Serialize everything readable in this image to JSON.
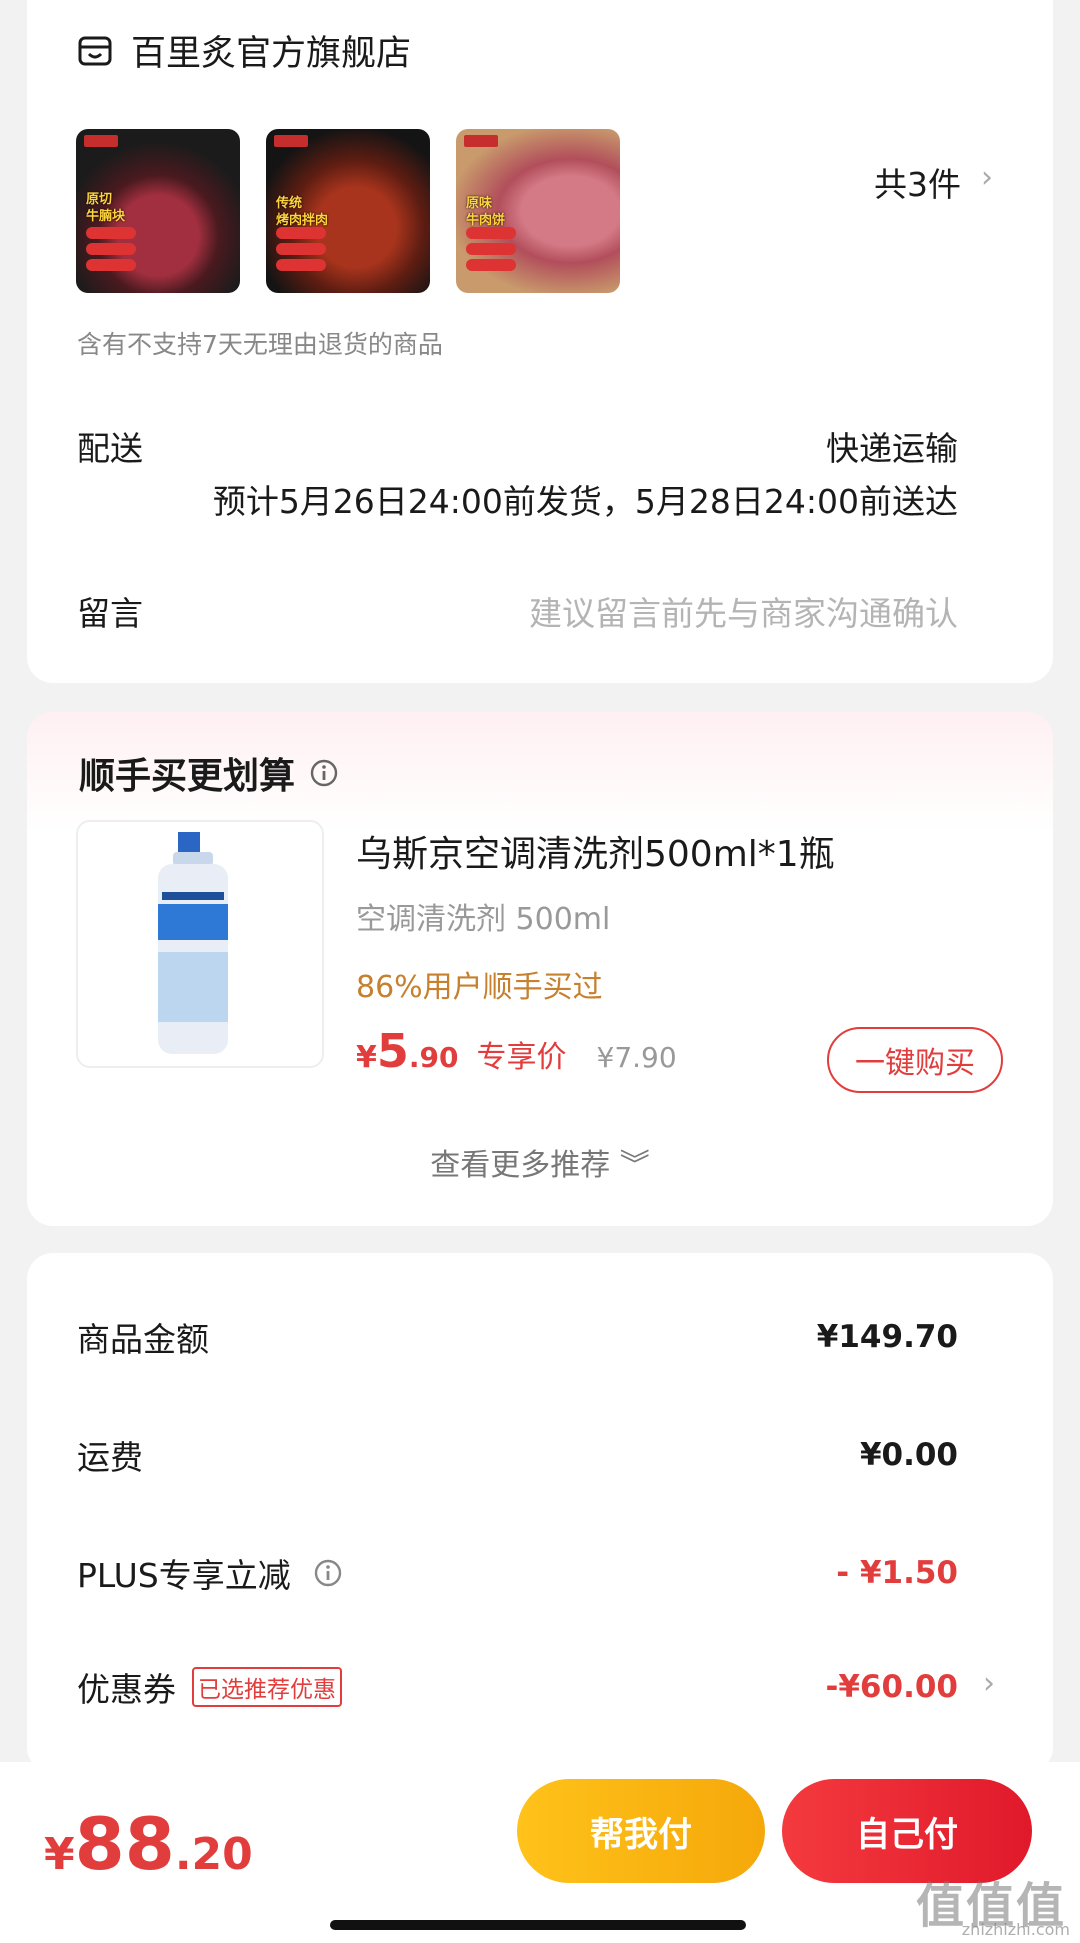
{
  "shop": {
    "name": "百里炙官方旗舰店"
  },
  "order": {
    "items_count": "共3件",
    "products": [
      {
        "caption": "原切\n牛腩块"
      },
      {
        "caption": "传统\n烤肉拌肉"
      },
      {
        "caption": "原味\n牛肉饼"
      }
    ],
    "return_note": "含有不支持7天无理由退货的商品",
    "shipping_label": "配送",
    "shipping_method": "快递运输",
    "shipping_time": "预计5月26日24:00前发货，5月28日24:00前送达",
    "message_label": "留言",
    "message_placeholder": "建议留言前先与商家沟通确认"
  },
  "recommend": {
    "title": "顺手买更划算",
    "product_name": "乌斯京空调清洗剂500ml*1瓶",
    "spec": "空调清洗剂 500ml",
    "social": "86%用户顺手买过",
    "price_yen": "¥",
    "price_int": "5",
    "price_dec": ".90",
    "price_tag": "专享价",
    "orig_price": "¥7.90",
    "buy_label": "一键购买",
    "more_label": "查看更多推荐 ︾"
  },
  "summary": {
    "goods_label": "商品金额",
    "goods_value": "¥149.70",
    "freight_label": "运费",
    "freight_value": "¥0.00",
    "plus_label": "PLUS专享立减",
    "plus_value": "- ¥1.50",
    "coupon_label": "优惠券",
    "coupon_badge": "已选推荐优惠",
    "coupon_value": "-¥60.00"
  },
  "bottom": {
    "total_yen": "¥",
    "total_int": "88",
    "total_dec": ".20",
    "help_pay": "帮我付",
    "self_pay": "自己付",
    "watermark": "值值值",
    "watermark_sub": "zhizhizhi.com"
  },
  "colors": {
    "accent": "#e23d3d",
    "gold": "#f5a80a",
    "social": "#c7802d"
  }
}
